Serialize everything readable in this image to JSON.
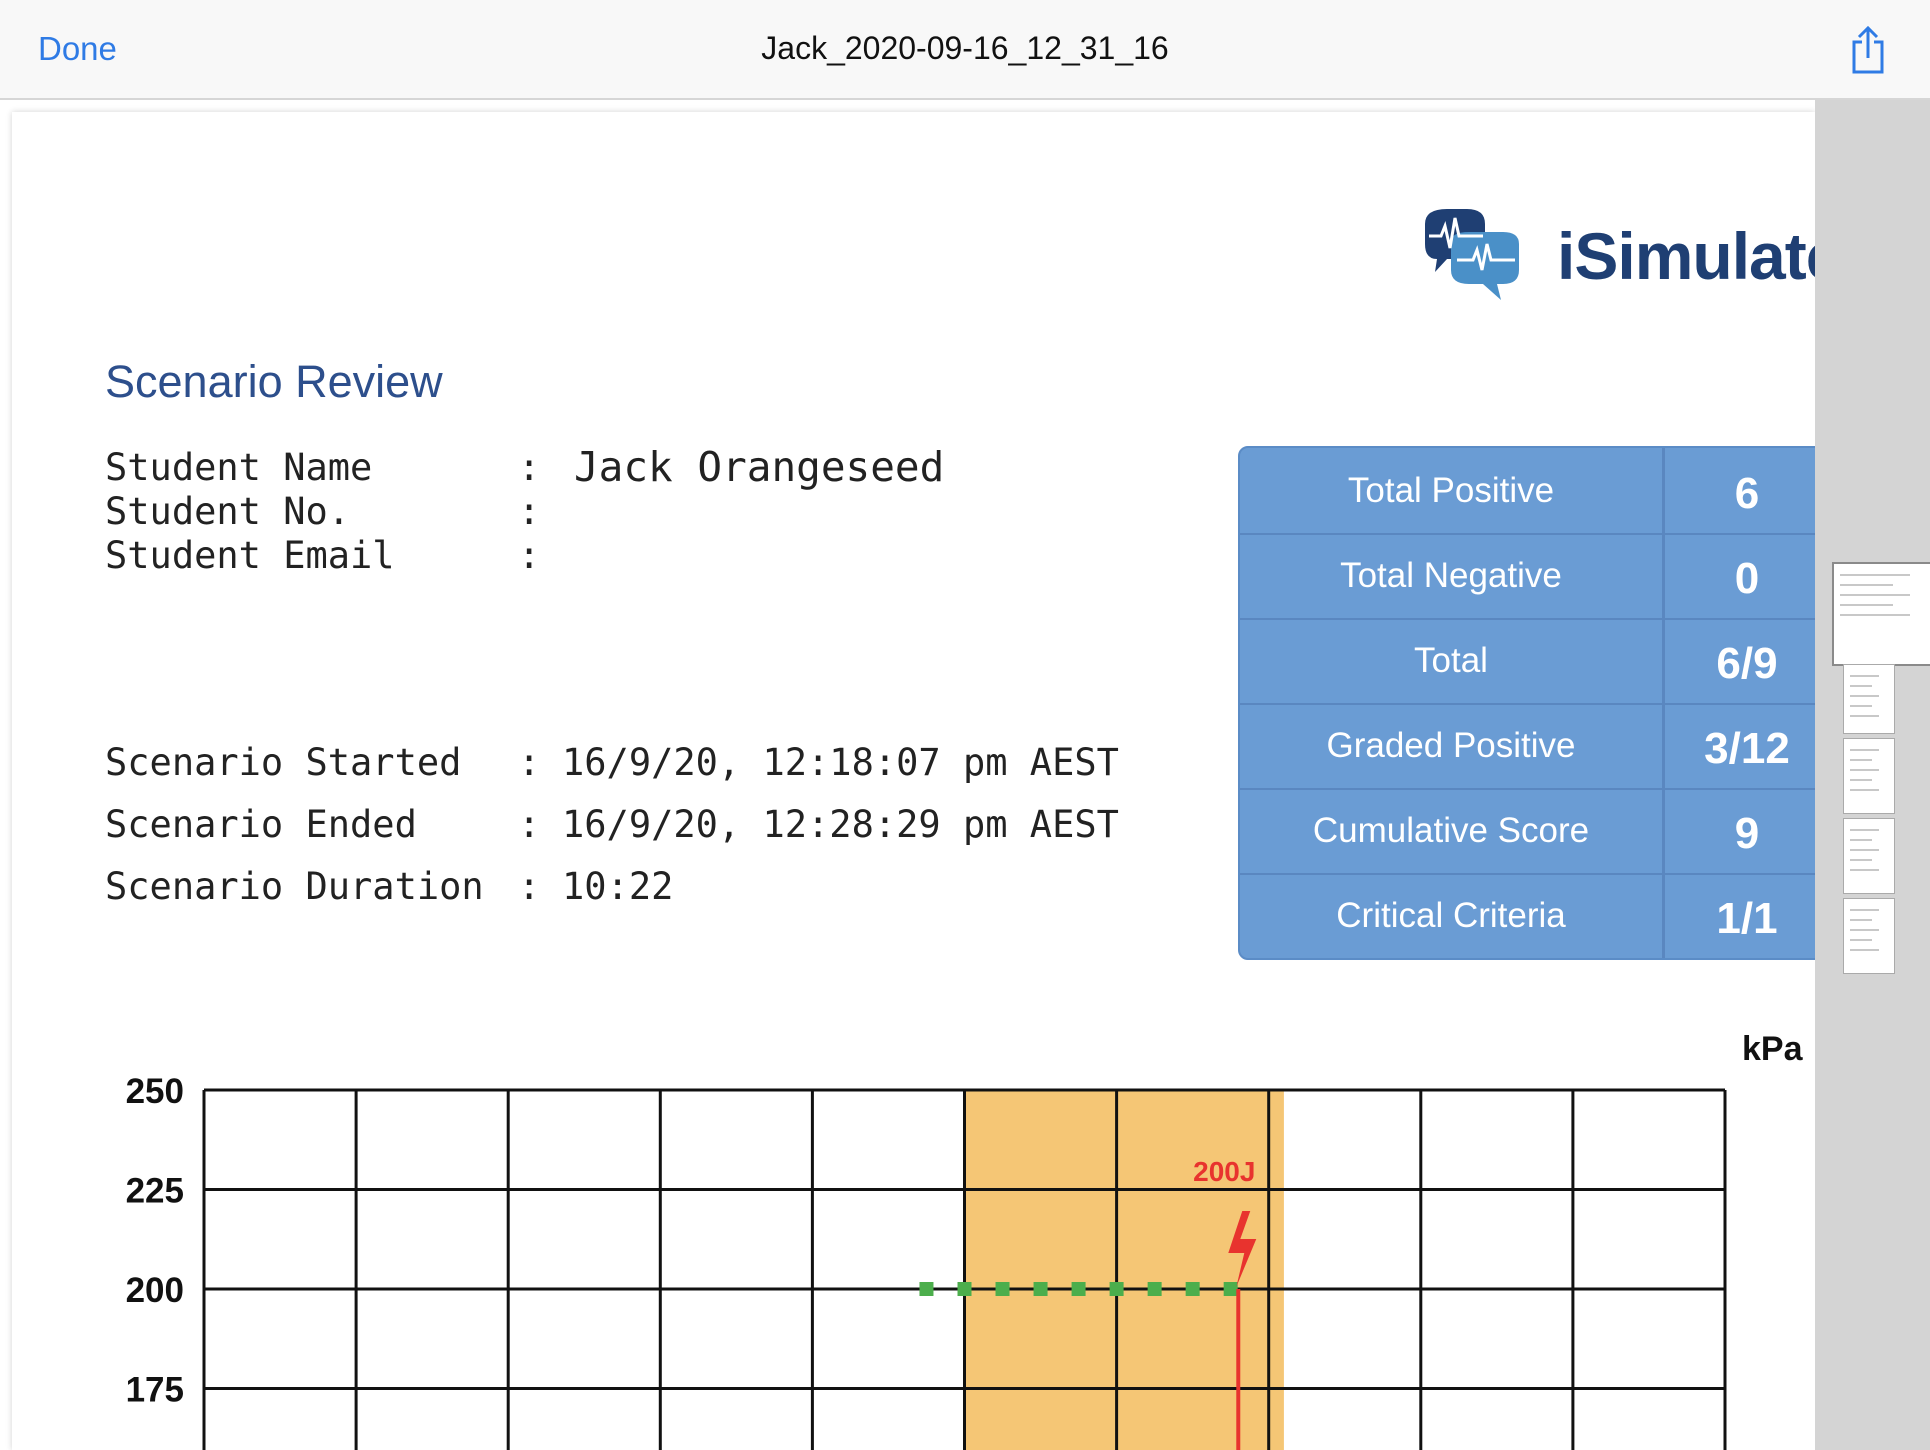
{
  "navbar": {
    "done_label": "Done",
    "title": "Jack_2020-09-16_12_31_16",
    "share_icon": "share-icon"
  },
  "logo": {
    "text": "iSimulate",
    "icon": "chat-bubbles-heartbeat-icon"
  },
  "review": {
    "title": "Scenario Review",
    "student": [
      {
        "label": "Student Name",
        "colon": ":",
        "value": "Jack Orangeseed"
      },
      {
        "label": "Student No.",
        "colon": ":",
        "value": ""
      },
      {
        "label": "Student Email",
        "colon": ":",
        "value": ""
      }
    ],
    "timing": [
      {
        "label": "Scenario Started",
        "colon": ":",
        "value": "16/9/20, 12:18:07 pm AEST"
      },
      {
        "label": "Scenario Ended",
        "colon": ":",
        "value": "16/9/20, 12:28:29 pm AEST"
      },
      {
        "label": "Scenario Duration",
        "colon": ":",
        "value": "10:22"
      }
    ]
  },
  "scores": [
    {
      "label": "Total Positive",
      "value": "6"
    },
    {
      "label": "Total Negative",
      "value": "0"
    },
    {
      "label": "Total",
      "value": "6/9"
    },
    {
      "label": "Graded Positive",
      "value": "3/12"
    },
    {
      "label": "Cumulative Score",
      "value": "9"
    },
    {
      "label": "Critical Criteria",
      "value": "1/1"
    }
  ],
  "colors": {
    "accent": "#2f7be5",
    "score_bg": "#6a9cd4",
    "highlight": "#f5c675",
    "marker": "#4cae4c",
    "shock": "#e8332e"
  },
  "chart_data": {
    "type": "line",
    "unit_label": "kPa",
    "yticks": [
      "250",
      "225",
      "200",
      "175"
    ],
    "ylim": [
      167,
      250
    ],
    "grid": true,
    "highlight_region": {
      "x_start": 5.0,
      "x_end": 7.1
    },
    "series": [
      {
        "values": [
          [
            4.75,
            200
          ],
          [
            5.0,
            200
          ],
          [
            5.25,
            200
          ],
          [
            5.5,
            200
          ],
          [
            5.75,
            200
          ],
          [
            6.0,
            200
          ],
          [
            6.25,
            200
          ],
          [
            6.5,
            200
          ],
          [
            6.75,
            200
          ]
        ]
      }
    ],
    "annotations": [
      {
        "label": "200J",
        "x": 6.8,
        "icon": "lightning-bolt-icon"
      }
    ]
  },
  "thumbnails": [
    "page-1",
    "page-2",
    "page-3",
    "page-4",
    "page-5"
  ]
}
